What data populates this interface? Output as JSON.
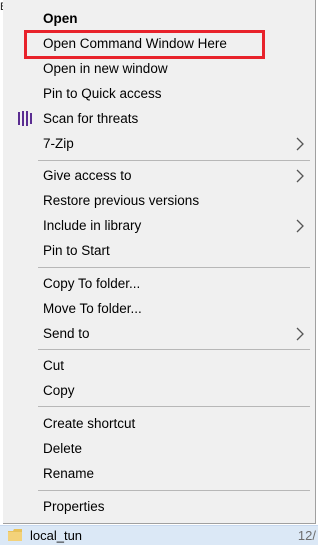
{
  "left_edge_text": "B",
  "menu": {
    "items": [
      {
        "label": "Open"
      },
      {
        "label": "Open Command Window Here"
      },
      {
        "label": "Open in new window"
      },
      {
        "label": "Pin to Quick access"
      },
      {
        "label": "Scan for threats",
        "icon": "defender-scan-icon"
      },
      {
        "label": "7-Zip",
        "submenu": true
      },
      {
        "label": "Give access to",
        "submenu": true
      },
      {
        "label": "Restore previous versions"
      },
      {
        "label": "Include in library",
        "submenu": true
      },
      {
        "label": "Pin to Start"
      },
      {
        "label": "Copy To folder..."
      },
      {
        "label": "Move To folder..."
      },
      {
        "label": "Send to",
        "submenu": true
      },
      {
        "label": "Cut"
      },
      {
        "label": "Copy"
      },
      {
        "label": "Create shortcut"
      },
      {
        "label": "Delete"
      },
      {
        "label": "Rename"
      },
      {
        "label": "Properties"
      }
    ]
  },
  "file_row": {
    "name": "local_tun",
    "date": "12/"
  },
  "colors": {
    "menu_background": "#f0f0f0",
    "highlight_border": "#e8222b",
    "selection_background": "#dbe8f6",
    "scan_icon": "#5a2d91"
  }
}
